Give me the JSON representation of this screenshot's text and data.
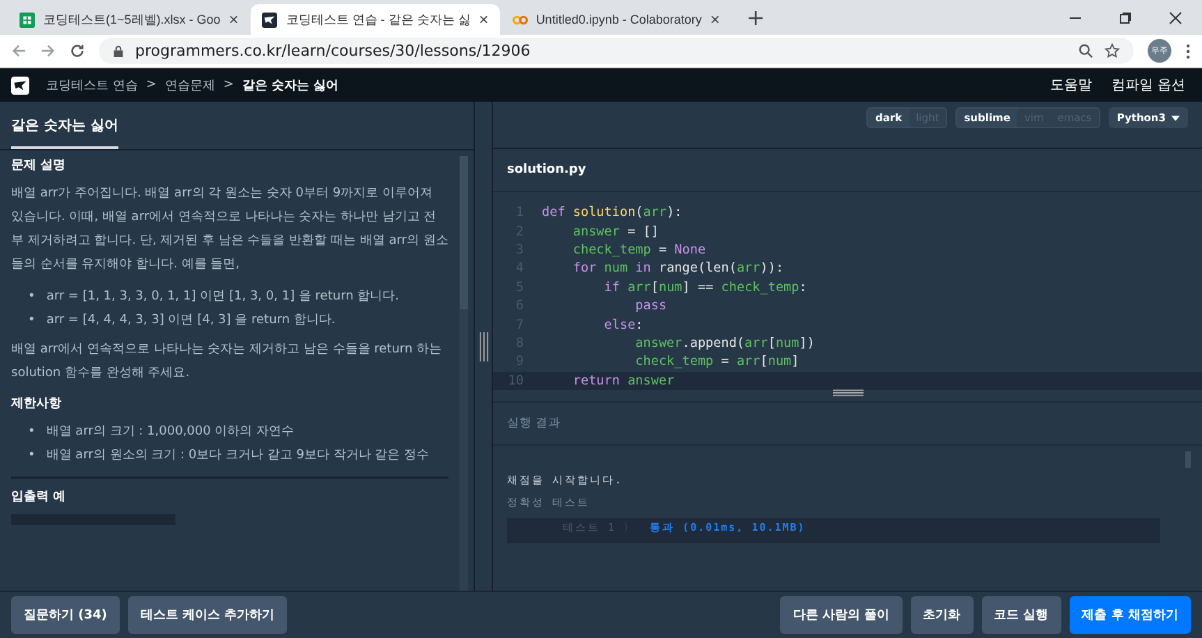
{
  "browser": {
    "tabs": [
      {
        "title": "코딩테스트(1~5레벨).xlsx - Goo",
        "kind": "sheet",
        "close": "×",
        "selected": false
      },
      {
        "title": "코딩테스트 연습 - 같은 숫자는 싫",
        "kind": "prog",
        "close": "×",
        "selected": true
      },
      {
        "title": "Untitled0.ipynb - Colaboratory",
        "kind": "colab",
        "close": "×",
        "selected": false
      }
    ],
    "new_tab": "+",
    "url": "programmers.co.kr/learn/courses/30/lessons/12906",
    "profile": "우주"
  },
  "nav": {
    "breadcrumb": [
      {
        "label": "코딩테스트 연습",
        "current": false
      },
      {
        "label": "연습문제",
        "current": false
      },
      {
        "label": "같은 숫자는 싫어",
        "current": true
      }
    ],
    "separator": ">",
    "links": [
      "도움말",
      "컴파일 옵션"
    ]
  },
  "problem_tab": {
    "label": "같은 숫자는 싫어",
    "selected": true
  },
  "problem": {
    "heading": "문제 설명",
    "paragraphs": [
      "배열 arr가 주어집니다. 배열 arr의 각 원소는 숫자 0부터 9까지로 이루어져 있습니다. 이때, 배열 arr에서 연속적으로 나타나는 숫자는 하나만 남기고 전부 제거하려고 합니다. 단, 제거된 후 남은 수들을 반환할 때는 배열 arr의 원소들의 순서를 유지해야 합니다. 예를 들면,"
    ],
    "bullet": "•",
    "examples": [
      "arr = [1, 1, 3, 3, 0, 1, 1] 이면 [1, 3, 0, 1] 을 return 합니다.",
      "arr = [4, 4, 4, 3, 3] 이면 [4, 3] 을 return 합니다."
    ],
    "closing": "배열 arr에서 연속적으로 나타나는 숫자는 제거하고 남은 수들을 return 하는 solution 함수를 완성해 주세요.",
    "limits_heading": "제한사항",
    "limits": [
      "배열 arr의 크기 : 1,000,000 이하의 자연수",
      "배열 arr의 원소의 크기 : 0보다 크거나 같고 9보다 작거나 같은 정수"
    ],
    "io_heading": "입출력 예"
  },
  "editor_options": {
    "themes": [
      {
        "label": "dark",
        "selected": true
      },
      {
        "label": "light",
        "selected": false
      }
    ],
    "keymaps": [
      {
        "label": "sublime",
        "selected": true
      },
      {
        "label": "vim",
        "selected": false
      },
      {
        "label": "emacs",
        "selected": false
      }
    ],
    "language": "Python3"
  },
  "editor": {
    "filename": "solution.py",
    "lines": [
      {
        "no": "1",
        "current": false,
        "tokens": [
          {
            "t": "def ",
            "kind": "kw"
          },
          {
            "t": "solution",
            "kind": "fn"
          },
          {
            "t": "(",
            "kind": "op"
          },
          {
            "t": "arr",
            "kind": "var"
          },
          {
            "t": "):",
            "kind": "op"
          }
        ]
      },
      {
        "no": "2",
        "current": false,
        "tokens": [
          {
            "t": "    answer",
            "kind": "var"
          },
          {
            "t": " = []",
            "kind": "op"
          }
        ]
      },
      {
        "no": "3",
        "current": false,
        "tokens": [
          {
            "t": "    check_temp",
            "kind": "var"
          },
          {
            "t": " = ",
            "kind": "op"
          },
          {
            "t": "None",
            "kind": "kw"
          }
        ]
      },
      {
        "no": "4",
        "current": false,
        "tokens": [
          {
            "t": "    for ",
            "kind": "kw"
          },
          {
            "t": "num ",
            "kind": "var"
          },
          {
            "t": "in ",
            "kind": "kw"
          },
          {
            "t": "range(len(",
            "kind": "op"
          },
          {
            "t": "arr",
            "kind": "var"
          },
          {
            "t": ")):",
            "kind": "op"
          }
        ]
      },
      {
        "no": "5",
        "current": false,
        "tokens": [
          {
            "t": "        if ",
            "kind": "kw"
          },
          {
            "t": "arr",
            "kind": "var"
          },
          {
            "t": "[",
            "kind": "op"
          },
          {
            "t": "num",
            "kind": "var"
          },
          {
            "t": "] == ",
            "kind": "op"
          },
          {
            "t": "check_temp",
            "kind": "var"
          },
          {
            "t": ":",
            "kind": "op"
          }
        ]
      },
      {
        "no": "6",
        "current": false,
        "tokens": [
          {
            "t": "            pass",
            "kind": "kw"
          }
        ]
      },
      {
        "no": "7",
        "current": false,
        "tokens": [
          {
            "t": "        else",
            "kind": "kw"
          },
          {
            "t": ":",
            "kind": "op"
          }
        ]
      },
      {
        "no": "8",
        "current": false,
        "tokens": [
          {
            "t": "            answer",
            "kind": "var"
          },
          {
            "t": ".append(",
            "kind": "op"
          },
          {
            "t": "arr",
            "kind": "var"
          },
          {
            "t": "[",
            "kind": "op"
          },
          {
            "t": "num",
            "kind": "var"
          },
          {
            "t": "])",
            "kind": "op"
          }
        ]
      },
      {
        "no": "9",
        "current": false,
        "tokens": [
          {
            "t": "            check_temp",
            "kind": "var"
          },
          {
            "t": " = ",
            "kind": "op"
          },
          {
            "t": "arr",
            "kind": "var"
          },
          {
            "t": "[",
            "kind": "op"
          },
          {
            "t": "num",
            "kind": "var"
          },
          {
            "t": "]",
            "kind": "op"
          }
        ]
      },
      {
        "no": "10",
        "current": true,
        "tokens": [
          {
            "t": "    return ",
            "kind": "kw"
          },
          {
            "t": "answer",
            "kind": "var"
          }
        ]
      }
    ]
  },
  "result": {
    "heading": "실행 결과",
    "lines": [
      "채점을 시작합니다.",
      "정확성  테스트"
    ],
    "tests": [
      {
        "label": "테스트 1 〉",
        "status": "통과 (0.01ms, 10.1MB)"
      }
    ]
  },
  "footer": {
    "left": [
      "질문하기 (34)",
      "테스트 케이스 추가하기"
    ],
    "right": [
      {
        "label": "다른 사람의 풀이",
        "primary": false
      },
      {
        "label": "초기화",
        "primary": false
      },
      {
        "label": "코드 실행",
        "primary": false
      },
      {
        "label": "제출 후 채점하기",
        "primary": true
      }
    ]
  }
}
